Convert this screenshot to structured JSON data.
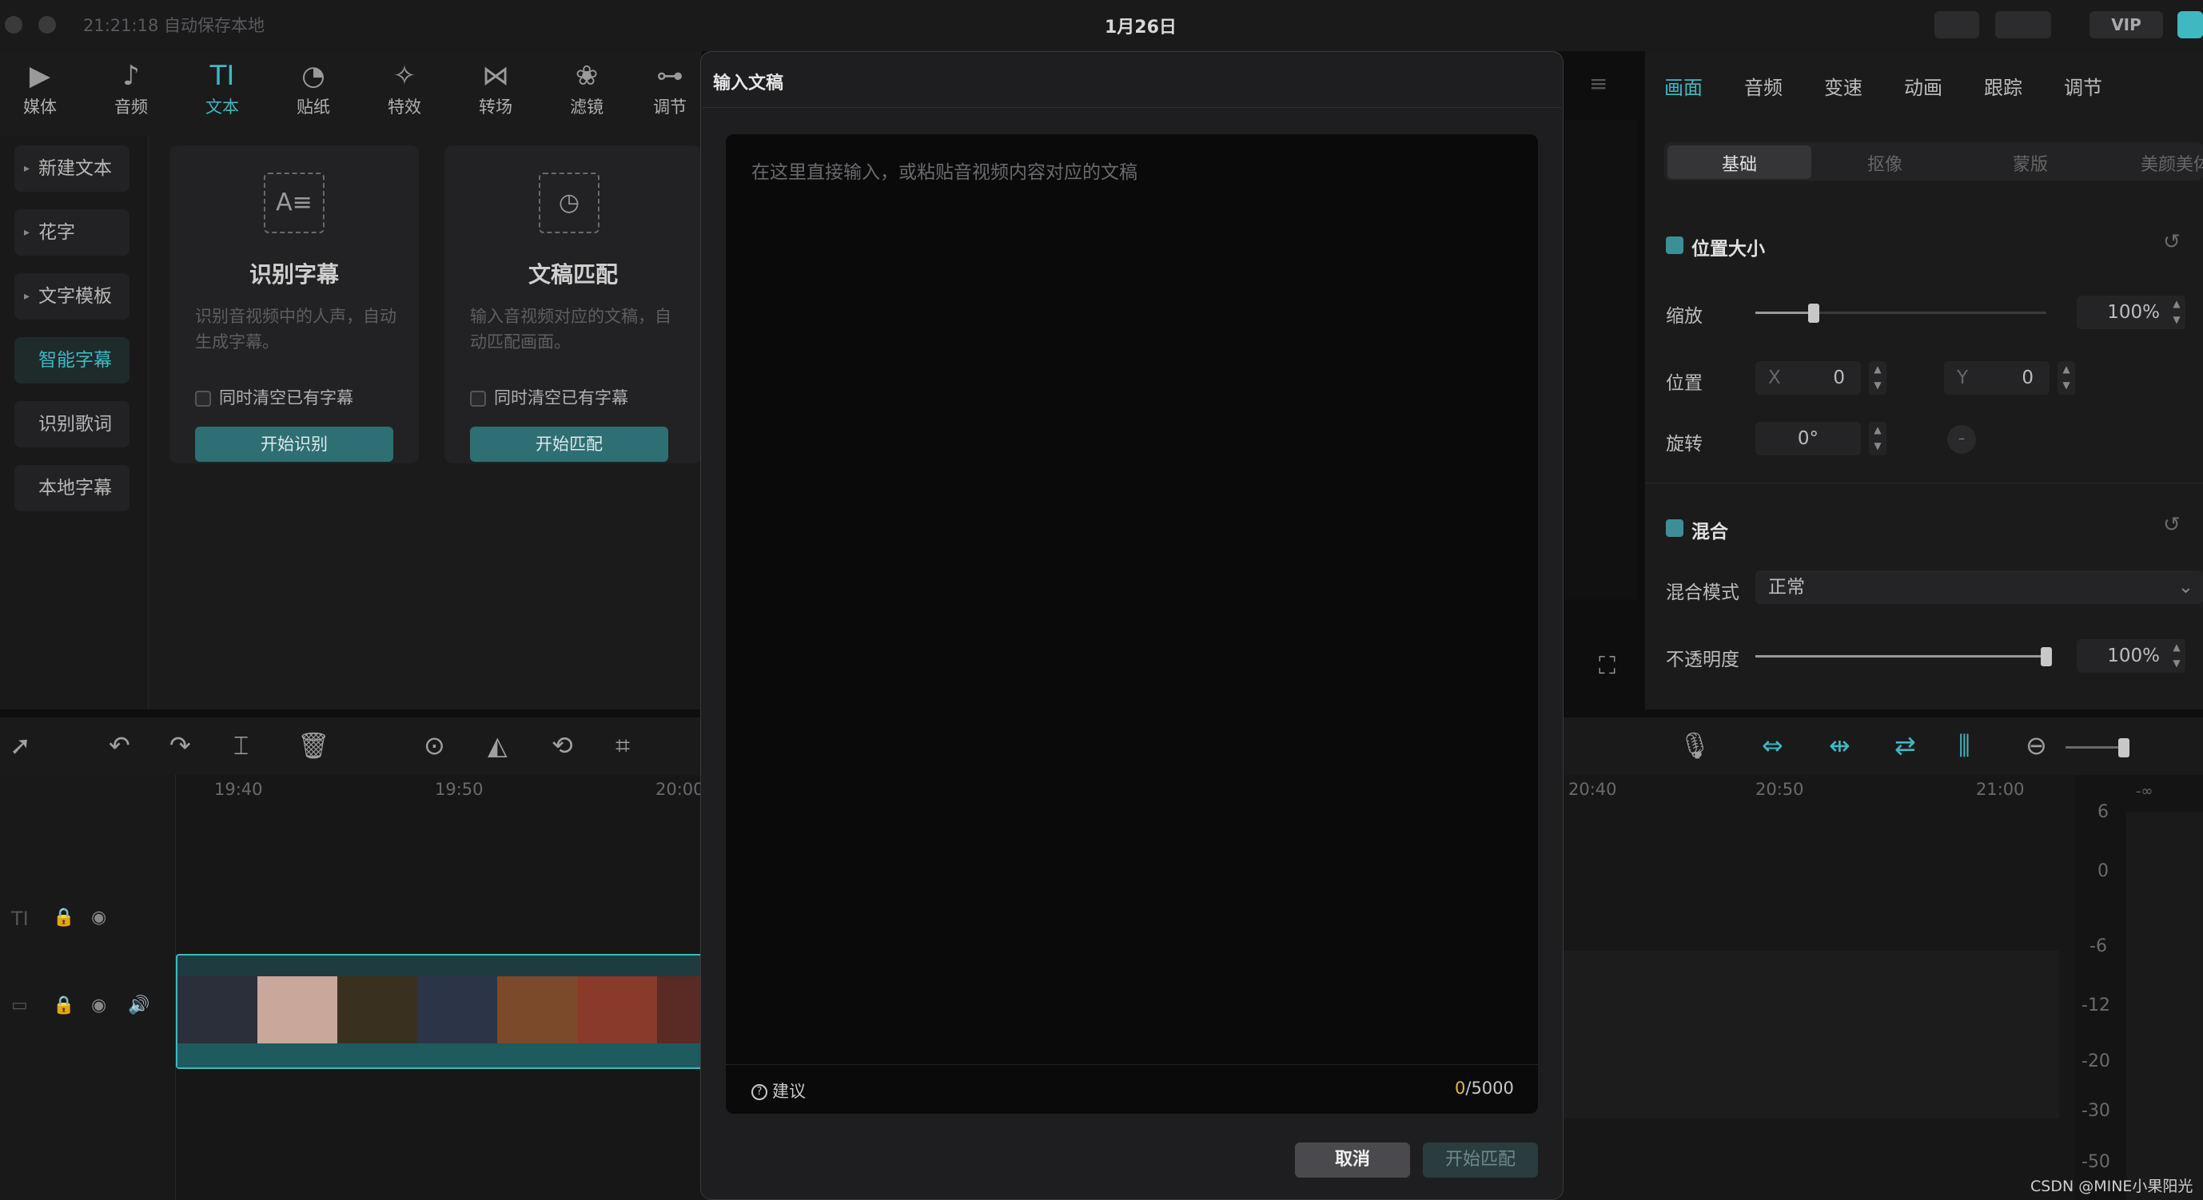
{
  "titlebar": {
    "autosave": "21:21:18 自动保存本地",
    "date": "1月26日",
    "vip": "VIP"
  },
  "top_tabs": [
    {
      "label": "媒体",
      "icon": "media-icon"
    },
    {
      "label": "音频",
      "icon": "audio-icon"
    },
    {
      "label": "文本",
      "icon": "text-icon"
    },
    {
      "label": "贴纸",
      "icon": "sticker-icon"
    },
    {
      "label": "特效",
      "icon": "effects-icon"
    },
    {
      "label": "转场",
      "icon": "transition-icon"
    },
    {
      "label": "滤镜",
      "icon": "filter-icon"
    },
    {
      "label": "调节",
      "icon": "adjust-icon"
    }
  ],
  "sidebar": {
    "items": [
      {
        "label": "新建文本"
      },
      {
        "label": "花字"
      },
      {
        "label": "文字模板"
      },
      {
        "label": "智能字幕"
      },
      {
        "label": "识别歌词"
      },
      {
        "label": "本地字幕"
      }
    ]
  },
  "cards": [
    {
      "title": "识别字幕",
      "desc": "识别音视频中的人声，自动生成字幕。",
      "check": "同时清空已有字幕",
      "button": "开始识别"
    },
    {
      "title": "文稿匹配",
      "desc": "输入音视频对应的文稿，自动匹配画面。",
      "check": "同时清空已有字幕",
      "button": "开始匹配"
    }
  ],
  "right_tabs": [
    "画面",
    "音频",
    "变速",
    "动画",
    "跟踪",
    "调节"
  ],
  "segments": [
    "基础",
    "抠像",
    "蒙版",
    "美颜美体"
  ],
  "props": {
    "position_size": "位置大小",
    "scale_label": "缩放",
    "scale_value": "100%",
    "scale_level": 0.2,
    "position_label": "位置",
    "x_prefix": "X",
    "x_value": "0",
    "y_prefix": "Y",
    "y_value": "0",
    "rotate_label": "旋转",
    "rotate_value": "0°",
    "blend": "混合",
    "blend_mode_label": "混合模式",
    "blend_mode_value": "正常",
    "opacity_label": "不透明度",
    "opacity_value": "100%",
    "opacity_level": 1.0
  },
  "ruler": [
    "19:40",
    "19:50",
    "20:00",
    "20:40",
    "20:50",
    "21:00"
  ],
  "meter_labels": [
    "-∞",
    "6",
    "0",
    "-6",
    "-12",
    "-20",
    "-30",
    "-50"
  ],
  "dialog": {
    "title": "输入文稿",
    "placeholder": "在这里直接输入，或粘贴音视频内容对应的文稿",
    "suggest": "建议",
    "count_current": "0",
    "count_max": "/5000",
    "cancel": "取消",
    "confirm": "开始匹配"
  },
  "watermark": "CSDN @MINE小果阳光",
  "colors": {
    "accent": "#3fb8c2",
    "counter": "#e0b84a"
  }
}
